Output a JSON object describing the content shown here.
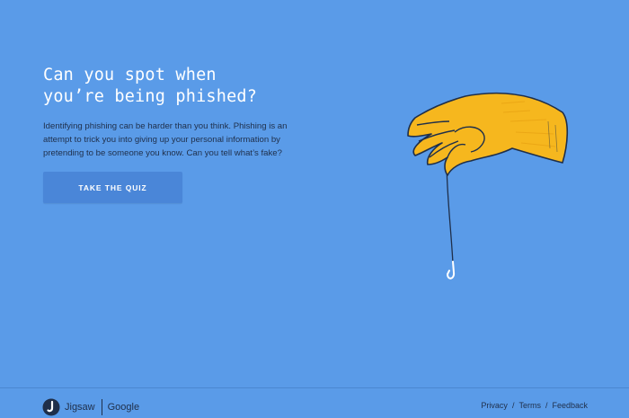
{
  "hero": {
    "title_line1": "Can you spot when",
    "title_line2": "you’re being phished?",
    "description": "Identifying phishing can be harder than you think. Phishing is an attempt to trick you into giving up your personal information by pretending to be someone you know. Can you tell what’s fake?",
    "cta_label": "TAKE THE QUIZ"
  },
  "illustration": {
    "icon": "hand-holding-fishing-hook",
    "hand_color": "#f6b71e",
    "outline_color": "#1f2f4a",
    "hook_color": "#ffffff"
  },
  "footer": {
    "brand_primary": "Jigsaw",
    "brand_secondary": "Google",
    "links": {
      "privacy": "Privacy",
      "terms": "Terms",
      "feedback": "Feedback"
    },
    "separator": "/"
  },
  "colors": {
    "background": "#5a9be8",
    "button": "#4a86d8",
    "title_text": "#ffffff",
    "body_text": "#1f2f4a"
  }
}
